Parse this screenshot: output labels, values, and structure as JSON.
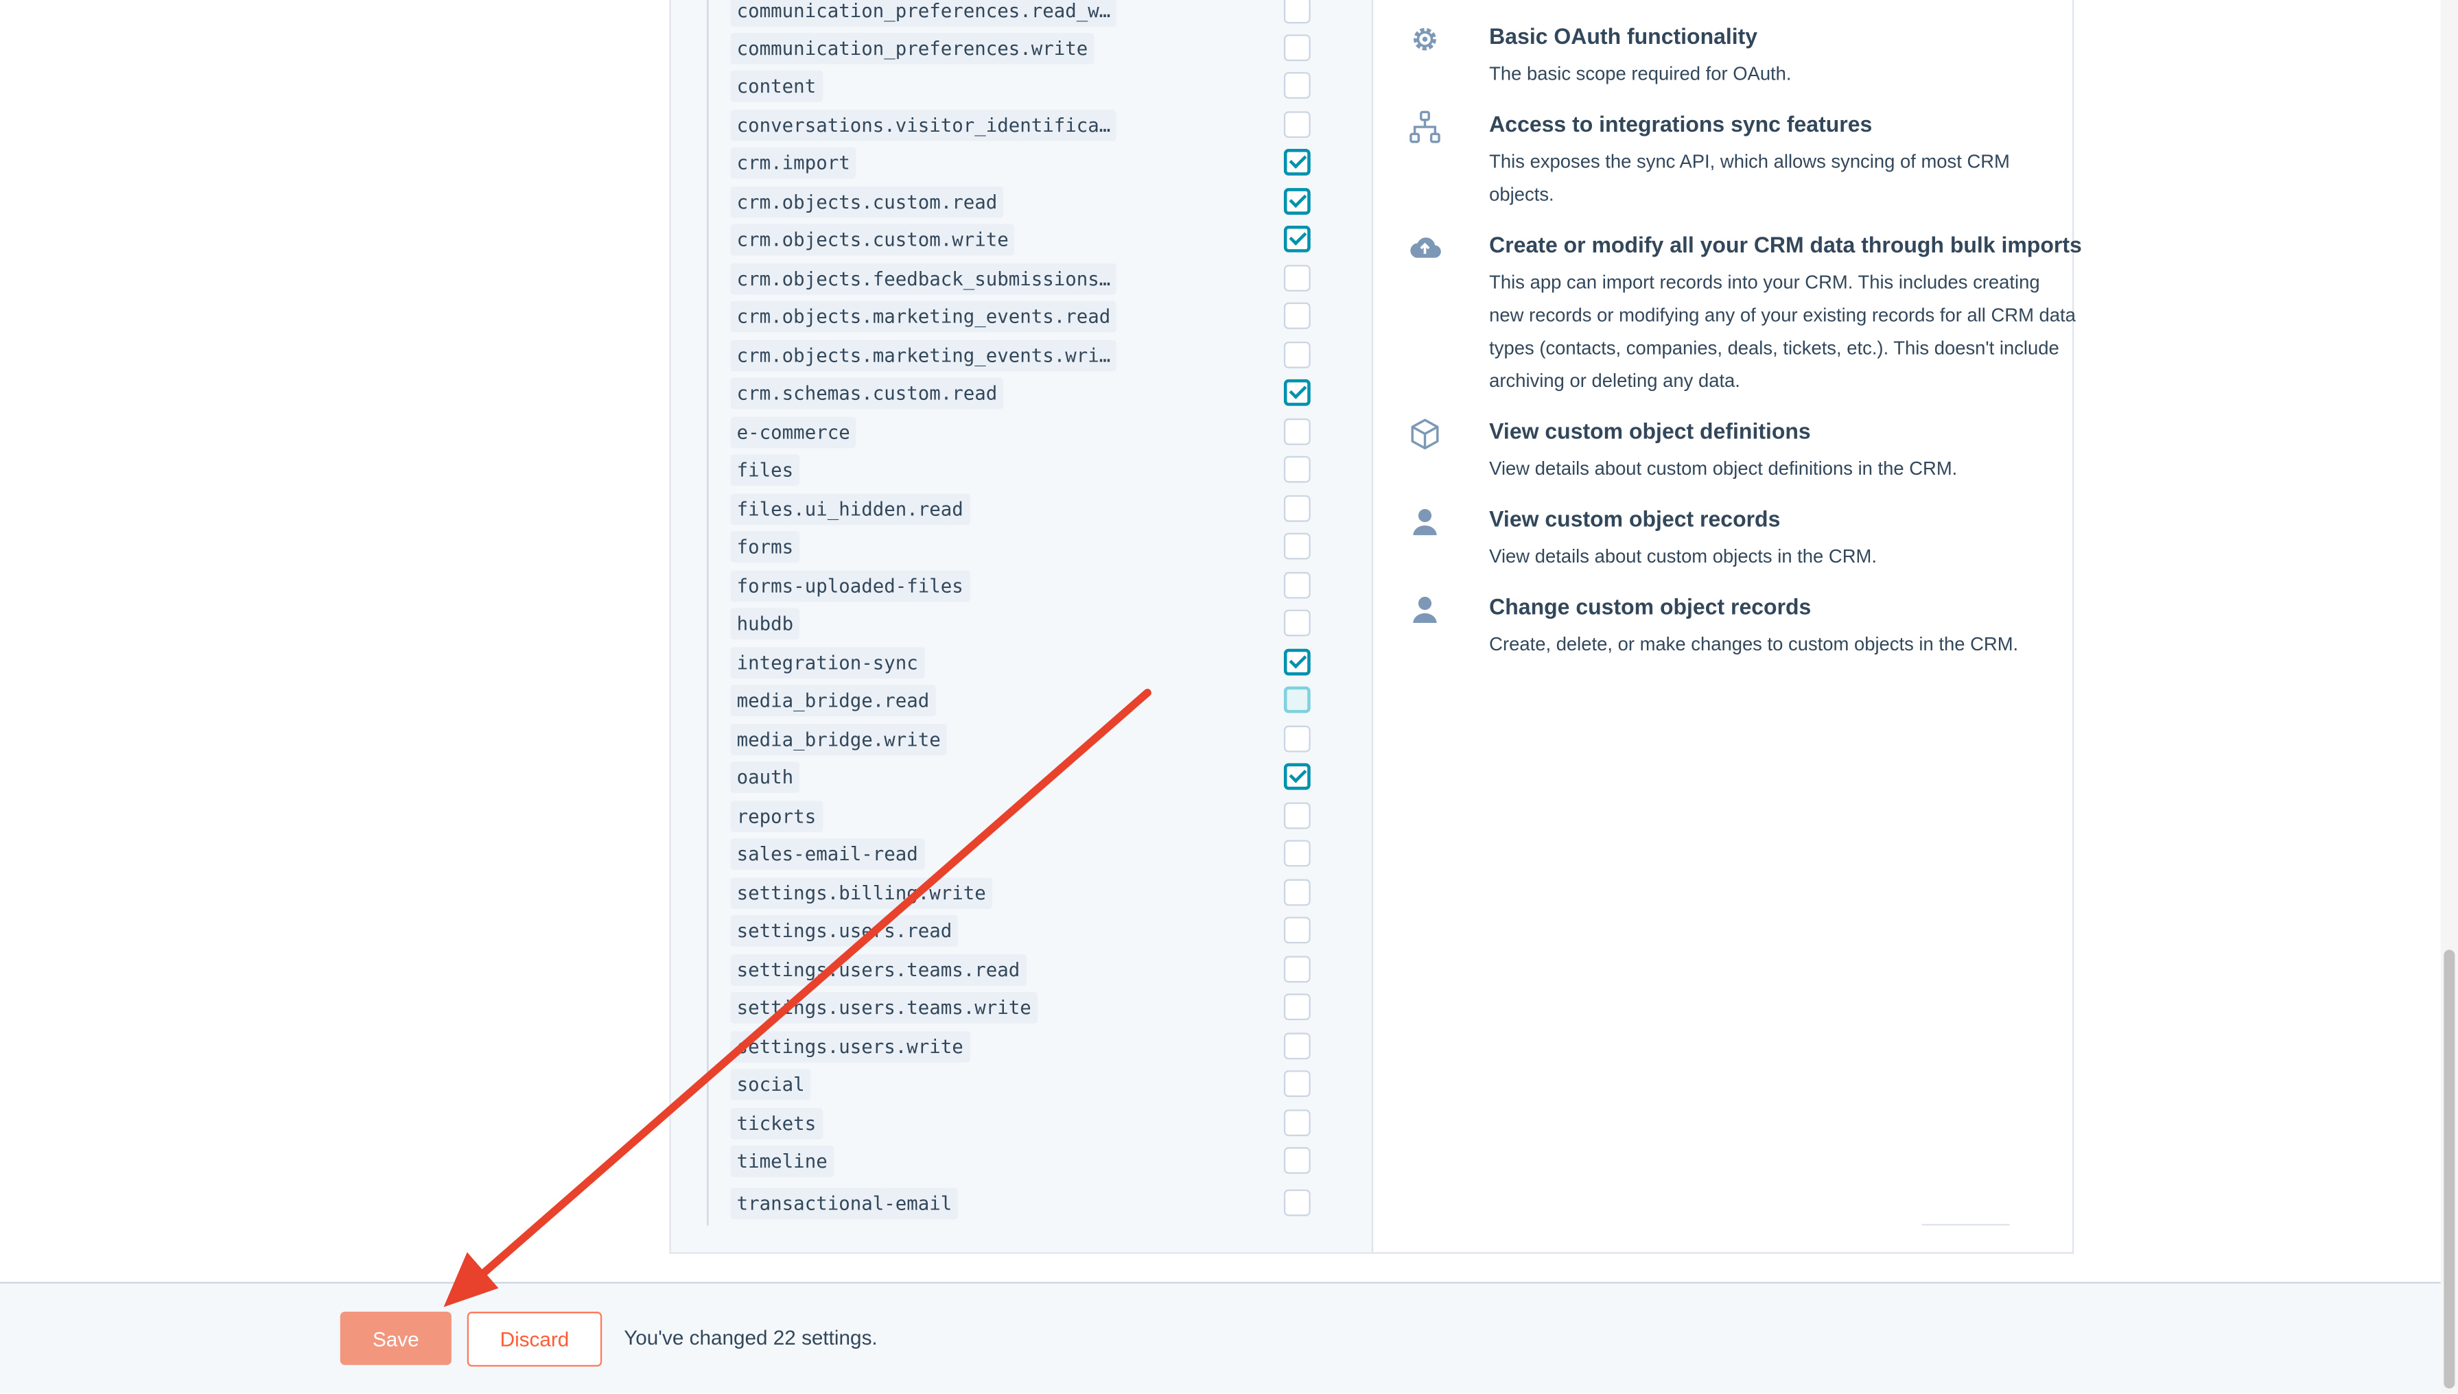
{
  "scopes": [
    {
      "name": "communication_preferences.read_w…",
      "checked": false
    },
    {
      "name": "communication_preferences.write",
      "checked": false
    },
    {
      "name": "content",
      "checked": false
    },
    {
      "name": "conversations.visitor_identifica…",
      "checked": false
    },
    {
      "name": "crm.import",
      "checked": true
    },
    {
      "name": "crm.objects.custom.read",
      "checked": true
    },
    {
      "name": "crm.objects.custom.write",
      "checked": true
    },
    {
      "name": "crm.objects.feedback_submissions…",
      "checked": false
    },
    {
      "name": "crm.objects.marketing_events.read",
      "checked": false
    },
    {
      "name": "crm.objects.marketing_events.wri…",
      "checked": false
    },
    {
      "name": "crm.schemas.custom.read",
      "checked": true
    },
    {
      "name": "e-commerce",
      "checked": false
    },
    {
      "name": "files",
      "checked": false
    },
    {
      "name": "files.ui_hidden.read",
      "checked": false
    },
    {
      "name": "forms",
      "checked": false
    },
    {
      "name": "forms-uploaded-files",
      "checked": false
    },
    {
      "name": "hubdb",
      "checked": false
    },
    {
      "name": "integration-sync",
      "checked": true
    },
    {
      "name": "media_bridge.read",
      "checked": false,
      "focused": true
    },
    {
      "name": "media_bridge.write",
      "checked": false
    },
    {
      "name": "oauth",
      "checked": true
    },
    {
      "name": "reports",
      "checked": false
    },
    {
      "name": "sales-email-read",
      "checked": false
    },
    {
      "name": "settings.billing.write",
      "checked": false
    },
    {
      "name": "settings.users.read",
      "checked": false
    },
    {
      "name": "settings.users.teams.read",
      "checked": false
    },
    {
      "name": "settings.users.teams.write",
      "checked": false
    },
    {
      "name": "settings.users.write",
      "checked": false
    },
    {
      "name": "social",
      "checked": false
    },
    {
      "name": "tickets",
      "checked": false
    },
    {
      "name": "timeline",
      "checked": false
    },
    {
      "name": "transactional-email",
      "checked": false
    }
  ],
  "permissions": [
    {
      "icon": "gear-icon",
      "title": "Basic OAuth functionality",
      "desc": "The basic scope required for OAuth."
    },
    {
      "icon": "sync-hierarchy-icon",
      "title": "Access to integrations sync features",
      "desc": "This exposes the sync API, which allows syncing of most CRM objects."
    },
    {
      "icon": "cloud-upload-icon",
      "title": "Create or modify all your CRM data through bulk imports",
      "desc": "This app can import records into your CRM. This includes creating new records or modifying any of your existing records for all CRM data types (contacts, companies, deals, tickets, etc.). This doesn't include archiving or deleting any data."
    },
    {
      "icon": "cube-icon",
      "title": "View custom object definitions",
      "desc": "View details about custom object definitions in the CRM."
    },
    {
      "icon": "person-icon",
      "title": "View custom object records",
      "desc": "View details about custom objects in the CRM."
    },
    {
      "icon": "person-icon",
      "title": "Change custom object records",
      "desc": "Create, delete, or make changes to custom objects in the CRM."
    }
  ],
  "footer": {
    "save_label": "Save",
    "discard_label": "Discard",
    "status": "You've changed 22 settings."
  },
  "colors": {
    "accent_teal": "#0091ae",
    "save_orange": "#f2977d",
    "discard_orange": "#ff5c35",
    "annotation_arrow": "#e8412c"
  }
}
